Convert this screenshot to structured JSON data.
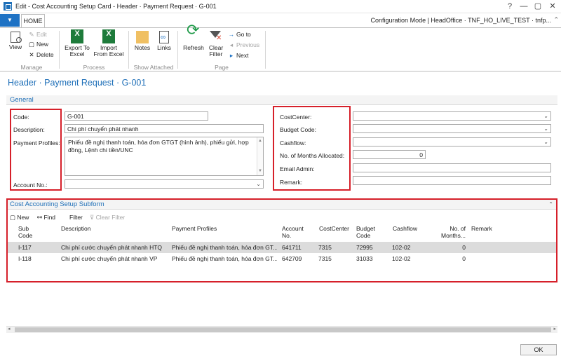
{
  "window": {
    "title": "Edit - Cost Accounting Setup Card - Header · Payment Request · G-001",
    "controls": [
      "?",
      "—",
      "▢",
      "✕"
    ]
  },
  "tabrow": {
    "menu_label": "▼",
    "home_tab": "HOME",
    "config_status": "Configuration Mode | HeadOffice · TNF_HO_LIVE_TEST · tnfp...",
    "caret": "⌃"
  },
  "ribbon": {
    "manage": {
      "label": "Manage",
      "view": "View",
      "edit": "Edit",
      "new": "New",
      "delete": "Delete"
    },
    "process": {
      "label": "Process",
      "export_line1": "Export To",
      "export_line2": "Excel",
      "import_line1": "Import",
      "import_line2": "From Excel"
    },
    "show_attached": {
      "label": "Show Attached",
      "notes": "Notes",
      "links": "Links"
    },
    "page": {
      "label": "Page",
      "refresh": "Refresh",
      "clear_filter_line1": "Clear",
      "clear_filter_line2": "Filter",
      "goto": "Go to",
      "previous": "Previous",
      "next": "Next"
    }
  },
  "page_title": "Header · Payment Request · G-001",
  "general": {
    "title": "General",
    "left": {
      "code_label": "Code:",
      "code_value": "G-001",
      "description_label": "Description:",
      "description_value": "Chi phí chuyển phát nhanh",
      "payment_profiles_label": "Payment Profiles:",
      "payment_profiles_value": "Phiếu đề nghị thanh toán, hóa đơn GTGT (hình ảnh), phiếu gửi, hợp đồng, Lệnh chi tiền/UNC",
      "account_no_label": "Account No.:",
      "account_no_value": ""
    },
    "right": {
      "costcenter_label": "CostCenter:",
      "budget_code_label": "Budget Code:",
      "cashflow_label": "Cashflow:",
      "months_label": "No. of Months Allocated:",
      "months_value": "0",
      "email_label": "Email Admin:",
      "remark_label": "Remark:"
    }
  },
  "subform": {
    "title": "Cost Accounting Setup Subform",
    "toolbar": {
      "new": "New",
      "find": "Find",
      "filter": "Filter",
      "clear_filter": "Clear Filter"
    },
    "columns": {
      "sub_code_1": "Sub",
      "sub_code_2": "Code",
      "description": "Description",
      "payment_profiles": "Payment Profiles",
      "account_1": "Account",
      "account_2": "No.",
      "costcenter": "CostCenter",
      "budget_1": "Budget",
      "budget_2": "Code",
      "cashflow": "Cashflow",
      "months_1": "No. of",
      "months_2": "Months...",
      "remark": "Remark"
    },
    "rows": [
      {
        "sub_code": "I-117",
        "description": "Chi phí cước chuyển phát nhanh HTQ",
        "payment_profiles": "Phiếu đề nghị thanh toán, hóa đơn GT...",
        "account_no": "641711",
        "costcenter": "7315",
        "budget_code": "72995",
        "cashflow": "102-02",
        "months": "0",
        "remark": ""
      },
      {
        "sub_code": "I-118",
        "description": "Chi phí cước chuyển phát nhanh VP",
        "payment_profiles": "Phiếu đề nghị thanh toán, hóa đơn GT...",
        "account_no": "642709",
        "costcenter": "7315",
        "budget_code": "31033",
        "cashflow": "102-02",
        "months": "0",
        "remark": ""
      }
    ]
  },
  "ok_button": "OK",
  "colors": {
    "accent": "#1e72c4",
    "title_blue": "#1e6fb8",
    "highlight_red": "#d6202a",
    "excel_green": "#1e7b3b"
  }
}
